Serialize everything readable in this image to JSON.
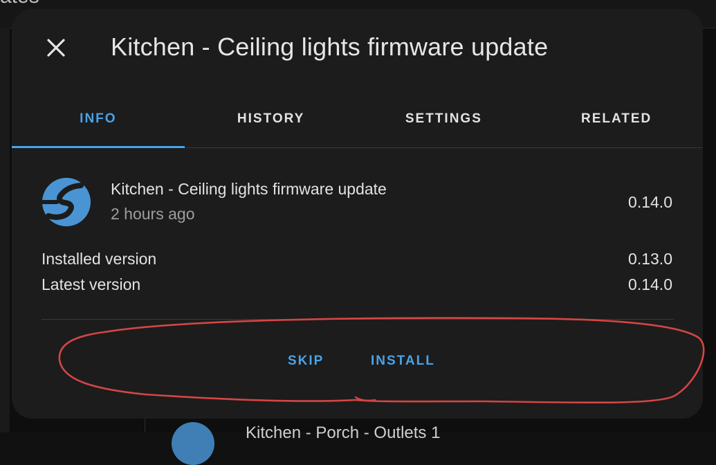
{
  "background": {
    "title_fragment": "ates",
    "list_item_text": "Kitchen - Porch - Outlets 1"
  },
  "dialog": {
    "title": "Kitchen - Ceiling lights firmware update",
    "close_icon": "close-icon",
    "tabs": [
      {
        "label": "INFO",
        "active": true
      },
      {
        "label": "HISTORY",
        "active": false
      },
      {
        "label": "SETTINGS",
        "active": false
      },
      {
        "label": "RELATED",
        "active": false
      }
    ],
    "entity": {
      "name": "Kitchen - Ceiling lights firmware update",
      "last_changed": "2 hours ago",
      "state": "0.14.0",
      "icon": "shelly-logo-icon"
    },
    "attributes": [
      {
        "label": "Installed version",
        "value": "0.13.0"
      },
      {
        "label": "Latest version",
        "value": "0.14.0"
      }
    ],
    "actions": {
      "skip_label": "SKIP",
      "install_label": "INSTALL"
    }
  },
  "colors": {
    "accent": "#4aa3e8",
    "dialog_bg": "#1c1c1c",
    "annotation": "#d64545"
  }
}
